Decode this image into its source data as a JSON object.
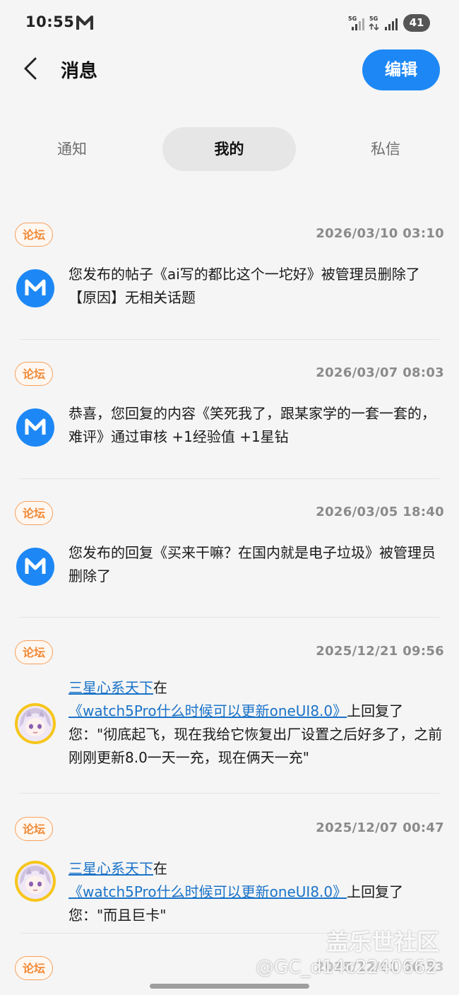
{
  "status_bar": {
    "time": "10:55",
    "signal1": "5G",
    "signal2": "5G",
    "battery": "41"
  },
  "header": {
    "title": "消息",
    "edit_label": "编辑"
  },
  "tabs": [
    {
      "label": "通知",
      "active": false
    },
    {
      "label": "我的",
      "active": true
    },
    {
      "label": "私信",
      "active": false
    }
  ],
  "messages": [
    {
      "badge": "论坛",
      "date": "2026/03/10 03:10",
      "avatar": "m-logo-icon",
      "text": "您发布的帖子《ai写的都比这个一坨好》被管理员删除了【原因】无相关话题"
    },
    {
      "badge": "论坛",
      "date": "2026/03/07 08:03",
      "avatar": "m-logo-icon",
      "text": "恭喜，您回复的内容《笑死我了，跟某家学的一套一套的，难评》通过审核 +1经验值 +1星钻"
    },
    {
      "badge": "论坛",
      "date": "2026/03/05 18:40",
      "avatar": "m-logo-icon",
      "text": "您发布的回复《买来干嘛？在国内就是电子垃圾》被管理员删除了"
    },
    {
      "badge": "论坛",
      "date": "2025/12/21 09:56",
      "avatar": "anime-avatar",
      "user": "三星心系天下",
      "in": "在",
      "link": "《watch5Pro什么时候可以更新oneUI8.0》",
      "text": "上回复了您：\"彻底起飞，现在我给它恢复出厂设置之后好多了，之前刚刚更新8.0一天一充，现在俩天一充\""
    },
    {
      "badge": "论坛",
      "date": "2025/12/07 00:47",
      "avatar": "anime-avatar",
      "user": "三星心系天下",
      "in": "在",
      "link": "《watch5Pro什么时候可以更新oneUI8.0》",
      "text": "上回复了您：\"而且巨卡\""
    },
    {
      "badge": "论坛",
      "date": "2025/12/01 06:53"
    }
  ],
  "watermark": {
    "line1": "盖乐世社区",
    "line2": "@GC_d14c2240662"
  },
  "colors": {
    "accent": "#1d88f5",
    "badge": "#f08a37",
    "link": "#1a73c8"
  }
}
